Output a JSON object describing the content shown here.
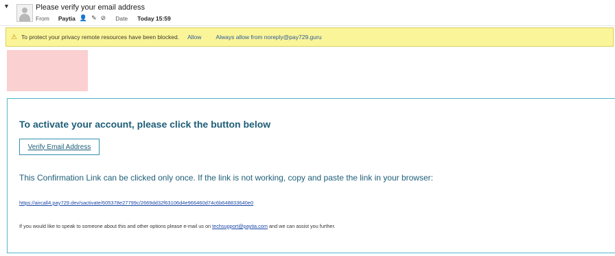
{
  "header": {
    "subject": "Please verify your email address",
    "from_label": "From",
    "from_name": "Paytia",
    "date_label": "Date",
    "date_value": "Today 15:59",
    "icons": [
      "chevron-down-icon",
      "avatar-icon",
      "add-contact-icon",
      "edit-icon",
      "block-icon"
    ]
  },
  "notice": {
    "message": "To protect your privacy remote resources have been blocked.",
    "allow": "Allow",
    "always_allow": "Always allow from noreply@pay729.guru",
    "icon": "warning-icon",
    "background": "#fbf59a"
  },
  "email": {
    "heading": "To activate your account, please click the button below",
    "button": "Verify Email Address",
    "confirmation": "This Confirmation Link can be clicked only once. If the link is not working, copy and paste the link in your browser:",
    "link": "https://aircall4.pay729.dev/sactivate/605378e27799c/2669dd32f63106d4e966460d74c6b648833640e0",
    "contact_before": "If you would like to speak to someone about this and other options please e-mail us on",
    "contact_email": "techsupport@paytia.com",
    "contact_after": "and we can assist you further.",
    "accent_color": "#1d5d78",
    "border_color": "#4fb7cc"
  }
}
